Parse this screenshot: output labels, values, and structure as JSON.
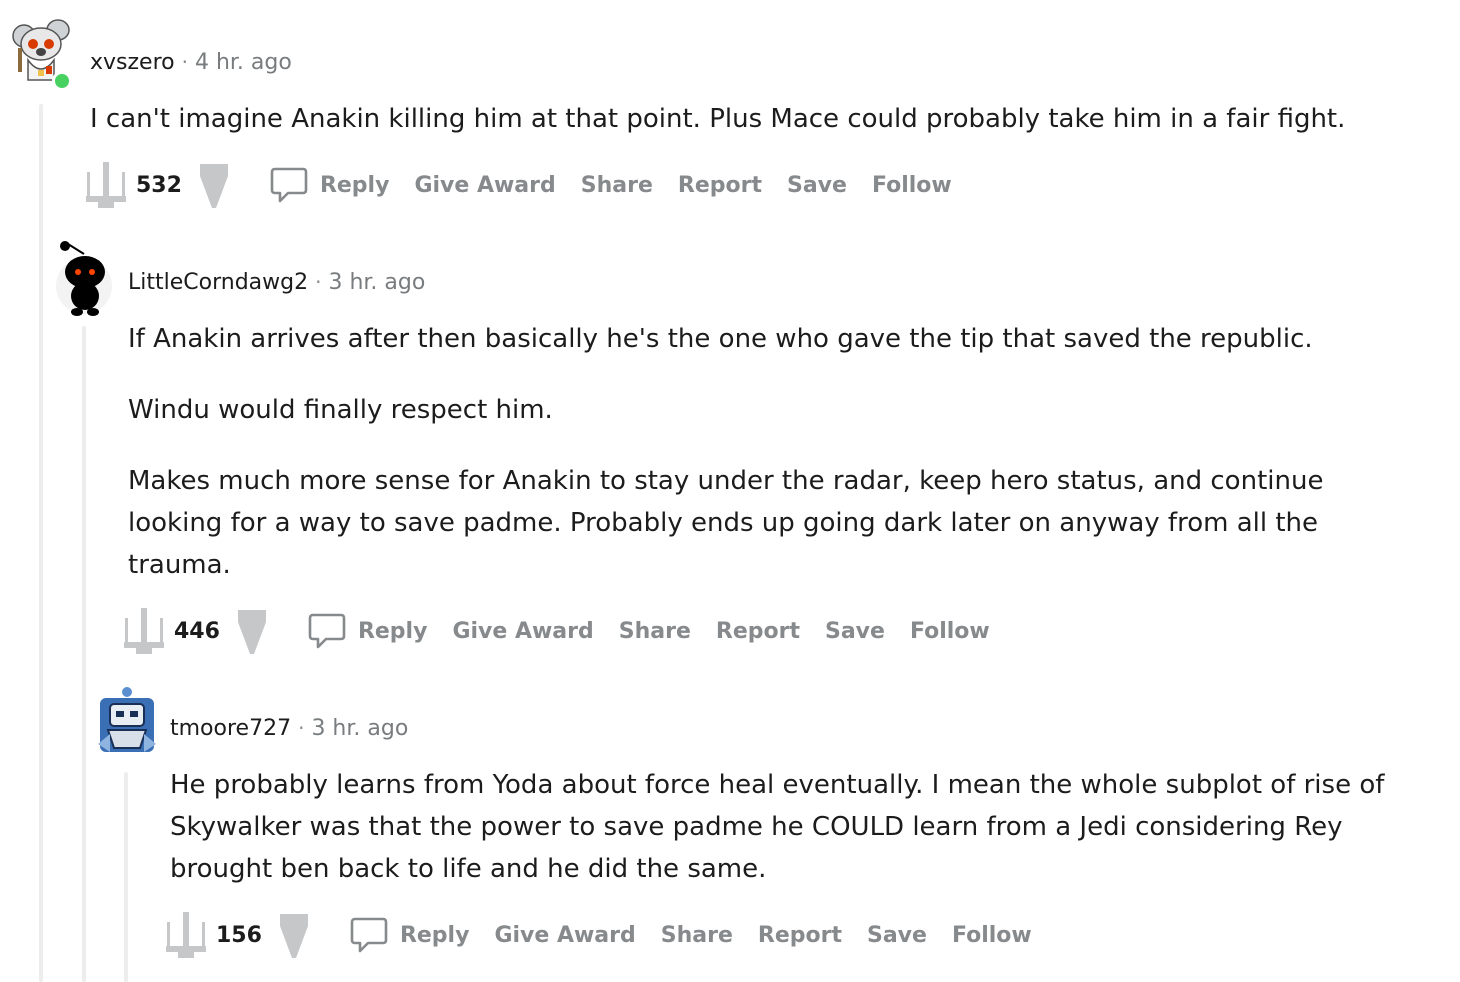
{
  "comments": [
    {
      "username": "xvszero",
      "separator": "·",
      "timestamp": "4 hr. ago",
      "paragraphs": [
        "I can't imagine Anakin killing him at that point. Plus Mace could probably take him in a fair fight."
      ],
      "score": "532",
      "actions": {
        "reply": "Reply",
        "give_award": "Give Award",
        "share": "Share",
        "report": "Report",
        "save": "Save",
        "follow": "Follow"
      },
      "online_status_color": "#46d160"
    },
    {
      "username": "LittleCorndawg2",
      "separator": "·",
      "timestamp": "3 hr. ago",
      "paragraphs": [
        "If Anakin arrives after then basically he's the one who gave the tip that saved the republic.",
        "Windu would finally respect him.",
        "Makes much more sense for Anakin to stay under the radar, keep hero status, and continue looking for a way to save padme. Probably ends up going dark later on anyway from all the trauma."
      ],
      "score": "446",
      "actions": {
        "reply": "Reply",
        "give_award": "Give Award",
        "share": "Share",
        "report": "Report",
        "save": "Save",
        "follow": "Follow"
      }
    },
    {
      "username": "tmoore727",
      "separator": "·",
      "timestamp": "3 hr. ago",
      "paragraphs": [
        "He probably learns from Yoda about force heal eventually. I mean the whole subplot of rise of Skywalker was that the power to save padme he COULD learn from a Jedi considering Rey brought ben back to life and he did the same."
      ],
      "score": "156",
      "actions": {
        "reply": "Reply",
        "give_award": "Give Award",
        "share": "Share",
        "report": "Report",
        "save": "Save",
        "follow": "Follow"
      }
    }
  ],
  "icons": {
    "upvote": "xwing-upvote-icon",
    "downvote": "downvote-icon",
    "reply": "speech-bubble-icon"
  },
  "colors": {
    "thread_line": "#ededed",
    "action_text": "#878a8c",
    "meta_text": "#787c7e",
    "body_text": "#1c1c1c"
  }
}
